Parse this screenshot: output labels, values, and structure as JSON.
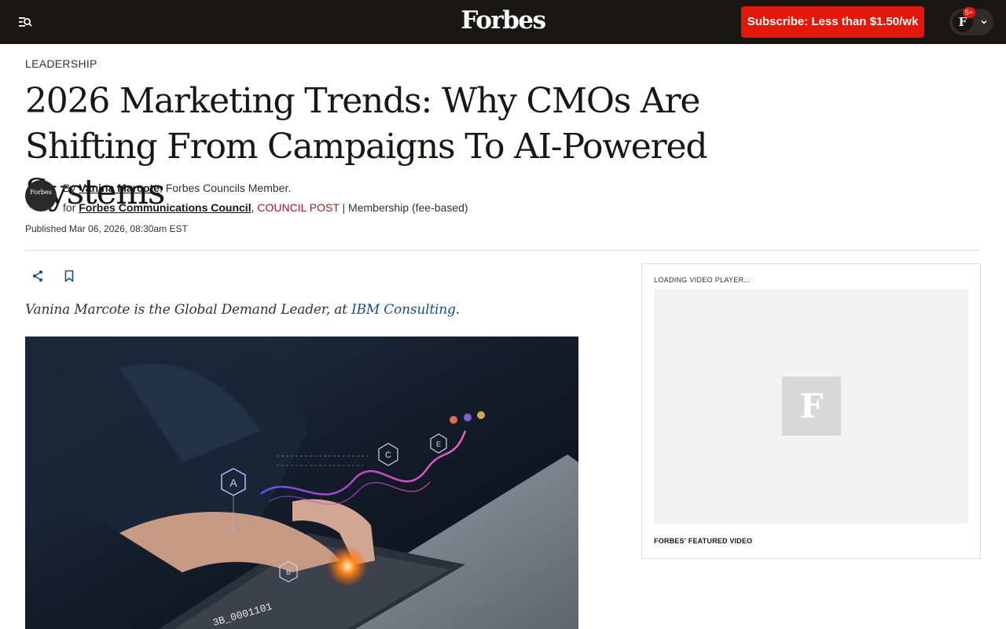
{
  "header": {
    "menu_icon": "menu-search-icon",
    "logo": "Forbes",
    "subscribe_label": "Subscribe: Less than $1.50/wk",
    "account": {
      "avatar_letter": "F",
      "notification_count": "5+",
      "chevron_icon": "chevron-down-icon"
    }
  },
  "article": {
    "section": "LEADERSHIP",
    "headline": "2026 Marketing Trends: Why CMOs Are Shifting From Campaigns To AI-Powered Systems",
    "author": {
      "avatar_text": "Forbes",
      "by_label": "By",
      "name": "Vanina Marcote",
      "role": "Forbes Councils Member.",
      "for_label": "for",
      "council": "Forbes Communications Council",
      "post_type": "COUNCIL POST",
      "membership": "| Membership (fee-based)"
    },
    "published": "Published Mar 06, 2026, 08:30am EST",
    "actions": {
      "share_icon": "share-icon",
      "bookmark_icon": "bookmark-icon"
    },
    "intro": {
      "prefix": "Vanina Marcote is the Global Demand Leader, at ",
      "link": "IBM Consulting",
      "suffix": "."
    },
    "hero_image": {
      "overlay_letters": [
        "A",
        "C",
        "E",
        "B"
      ],
      "overlay_code": "3B_0001101"
    }
  },
  "video": {
    "loading_label": "LOADING VIDEO PLAYER...",
    "placeholder_letter": "F",
    "caption": "FORBES' FEATURED VIDEO"
  },
  "colors": {
    "topbar": "#181716",
    "subscribe": "#e3170a",
    "council_post": "#9a1d1d",
    "link_blue": "#1a4c8b"
  }
}
